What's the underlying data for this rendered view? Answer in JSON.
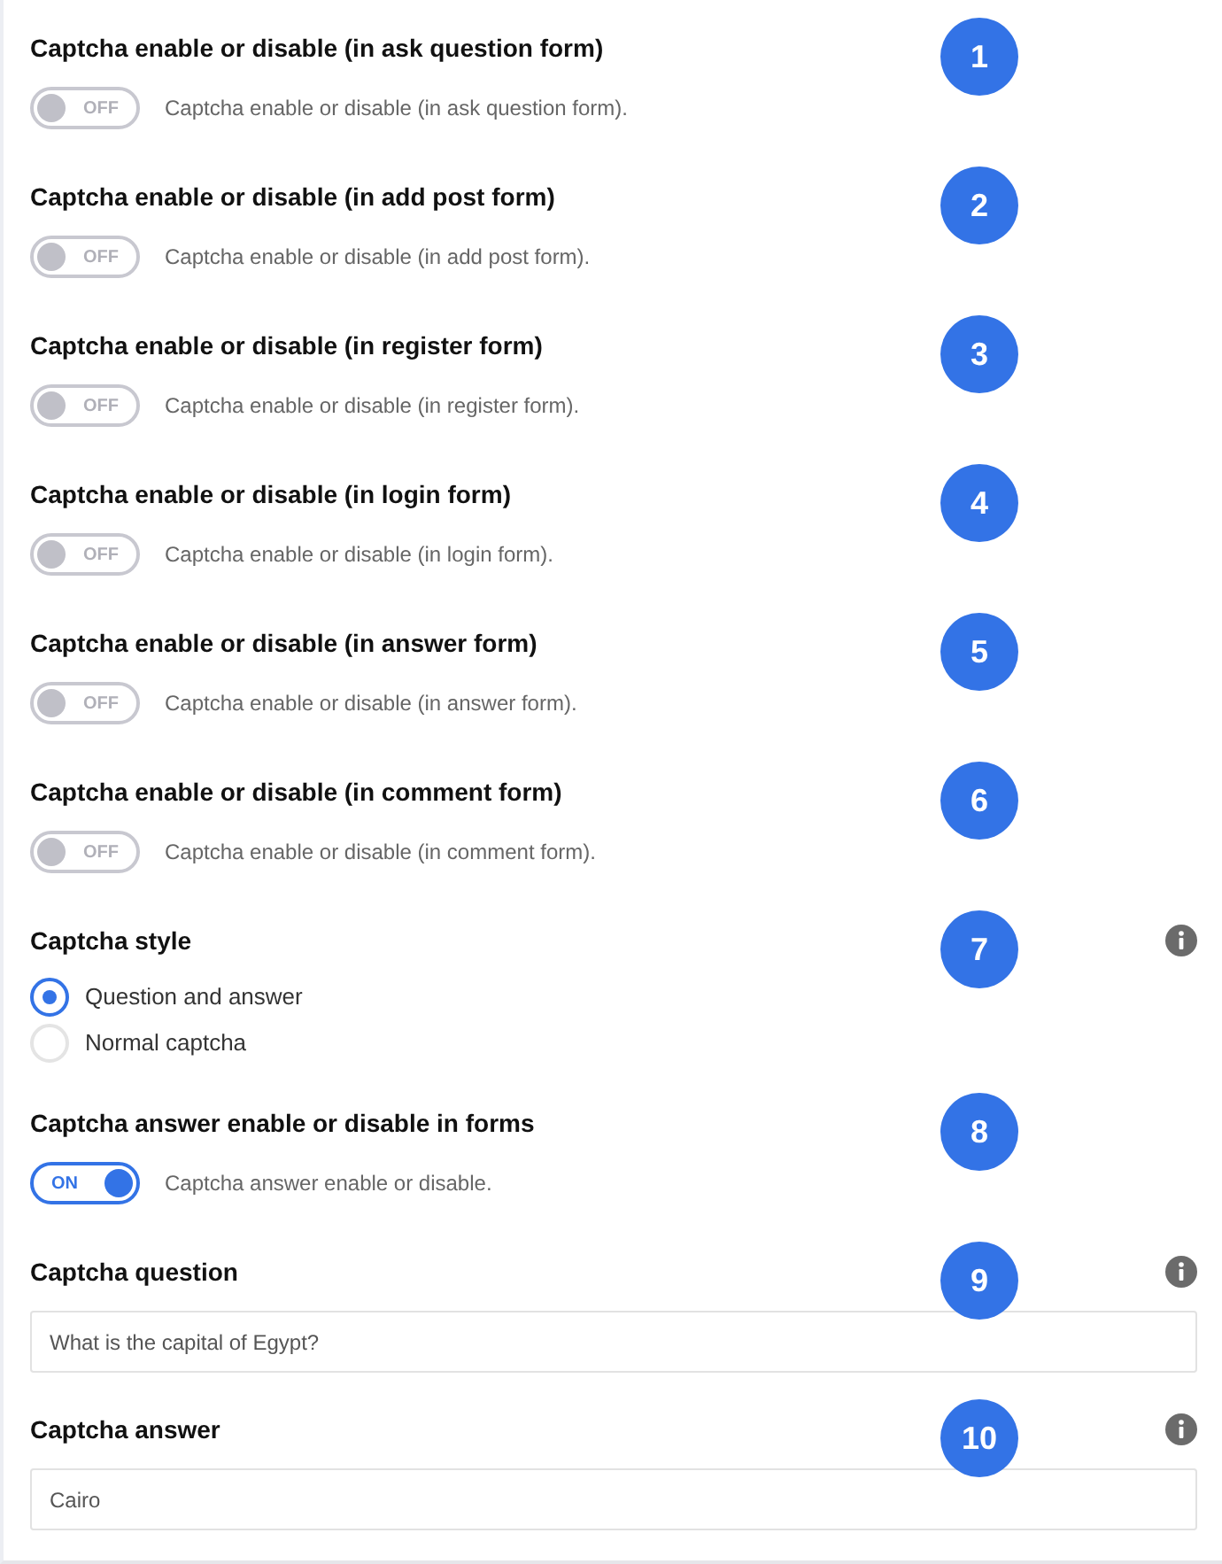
{
  "settings": [
    {
      "kind": "toggle",
      "title": "Captcha enable or disable (in ask question form)",
      "badge": "1",
      "info": false,
      "on": false,
      "switch_label": "OFF",
      "description": "Captcha enable or disable (in ask question form)."
    },
    {
      "kind": "toggle",
      "title": "Captcha enable or disable (in add post form)",
      "badge": "2",
      "info": false,
      "on": false,
      "switch_label": "OFF",
      "description": "Captcha enable or disable (in add post form)."
    },
    {
      "kind": "toggle",
      "title": "Captcha enable or disable (in register form)",
      "badge": "3",
      "info": false,
      "on": false,
      "switch_label": "OFF",
      "description": "Captcha enable or disable (in register form)."
    },
    {
      "kind": "toggle",
      "title": "Captcha enable or disable (in login form)",
      "badge": "4",
      "info": false,
      "on": false,
      "switch_label": "OFF",
      "description": "Captcha enable or disable (in login form)."
    },
    {
      "kind": "toggle",
      "title": "Captcha enable or disable (in answer form)",
      "badge": "5",
      "info": false,
      "on": false,
      "switch_label": "OFF",
      "description": "Captcha enable or disable (in answer form)."
    },
    {
      "kind": "toggle",
      "title": "Captcha enable or disable (in comment form)",
      "badge": "6",
      "info": false,
      "on": false,
      "switch_label": "OFF",
      "description": "Captcha enable or disable (in comment form)."
    },
    {
      "kind": "radio",
      "title": "Captcha style",
      "badge": "7",
      "info": true,
      "options": [
        {
          "label": "Question and answer",
          "selected": true
        },
        {
          "label": "Normal captcha",
          "selected": false
        }
      ]
    },
    {
      "kind": "toggle",
      "title": "Captcha answer enable or disable in forms",
      "badge": "8",
      "info": false,
      "on": true,
      "switch_label": "ON",
      "description": "Captcha answer enable or disable."
    },
    {
      "kind": "text",
      "title": "Captcha question",
      "badge": "9",
      "info": true,
      "value": "What is the capital of Egypt?"
    },
    {
      "kind": "text",
      "title": "Captcha answer",
      "badge": "10",
      "info": true,
      "value": "Cairo"
    }
  ]
}
